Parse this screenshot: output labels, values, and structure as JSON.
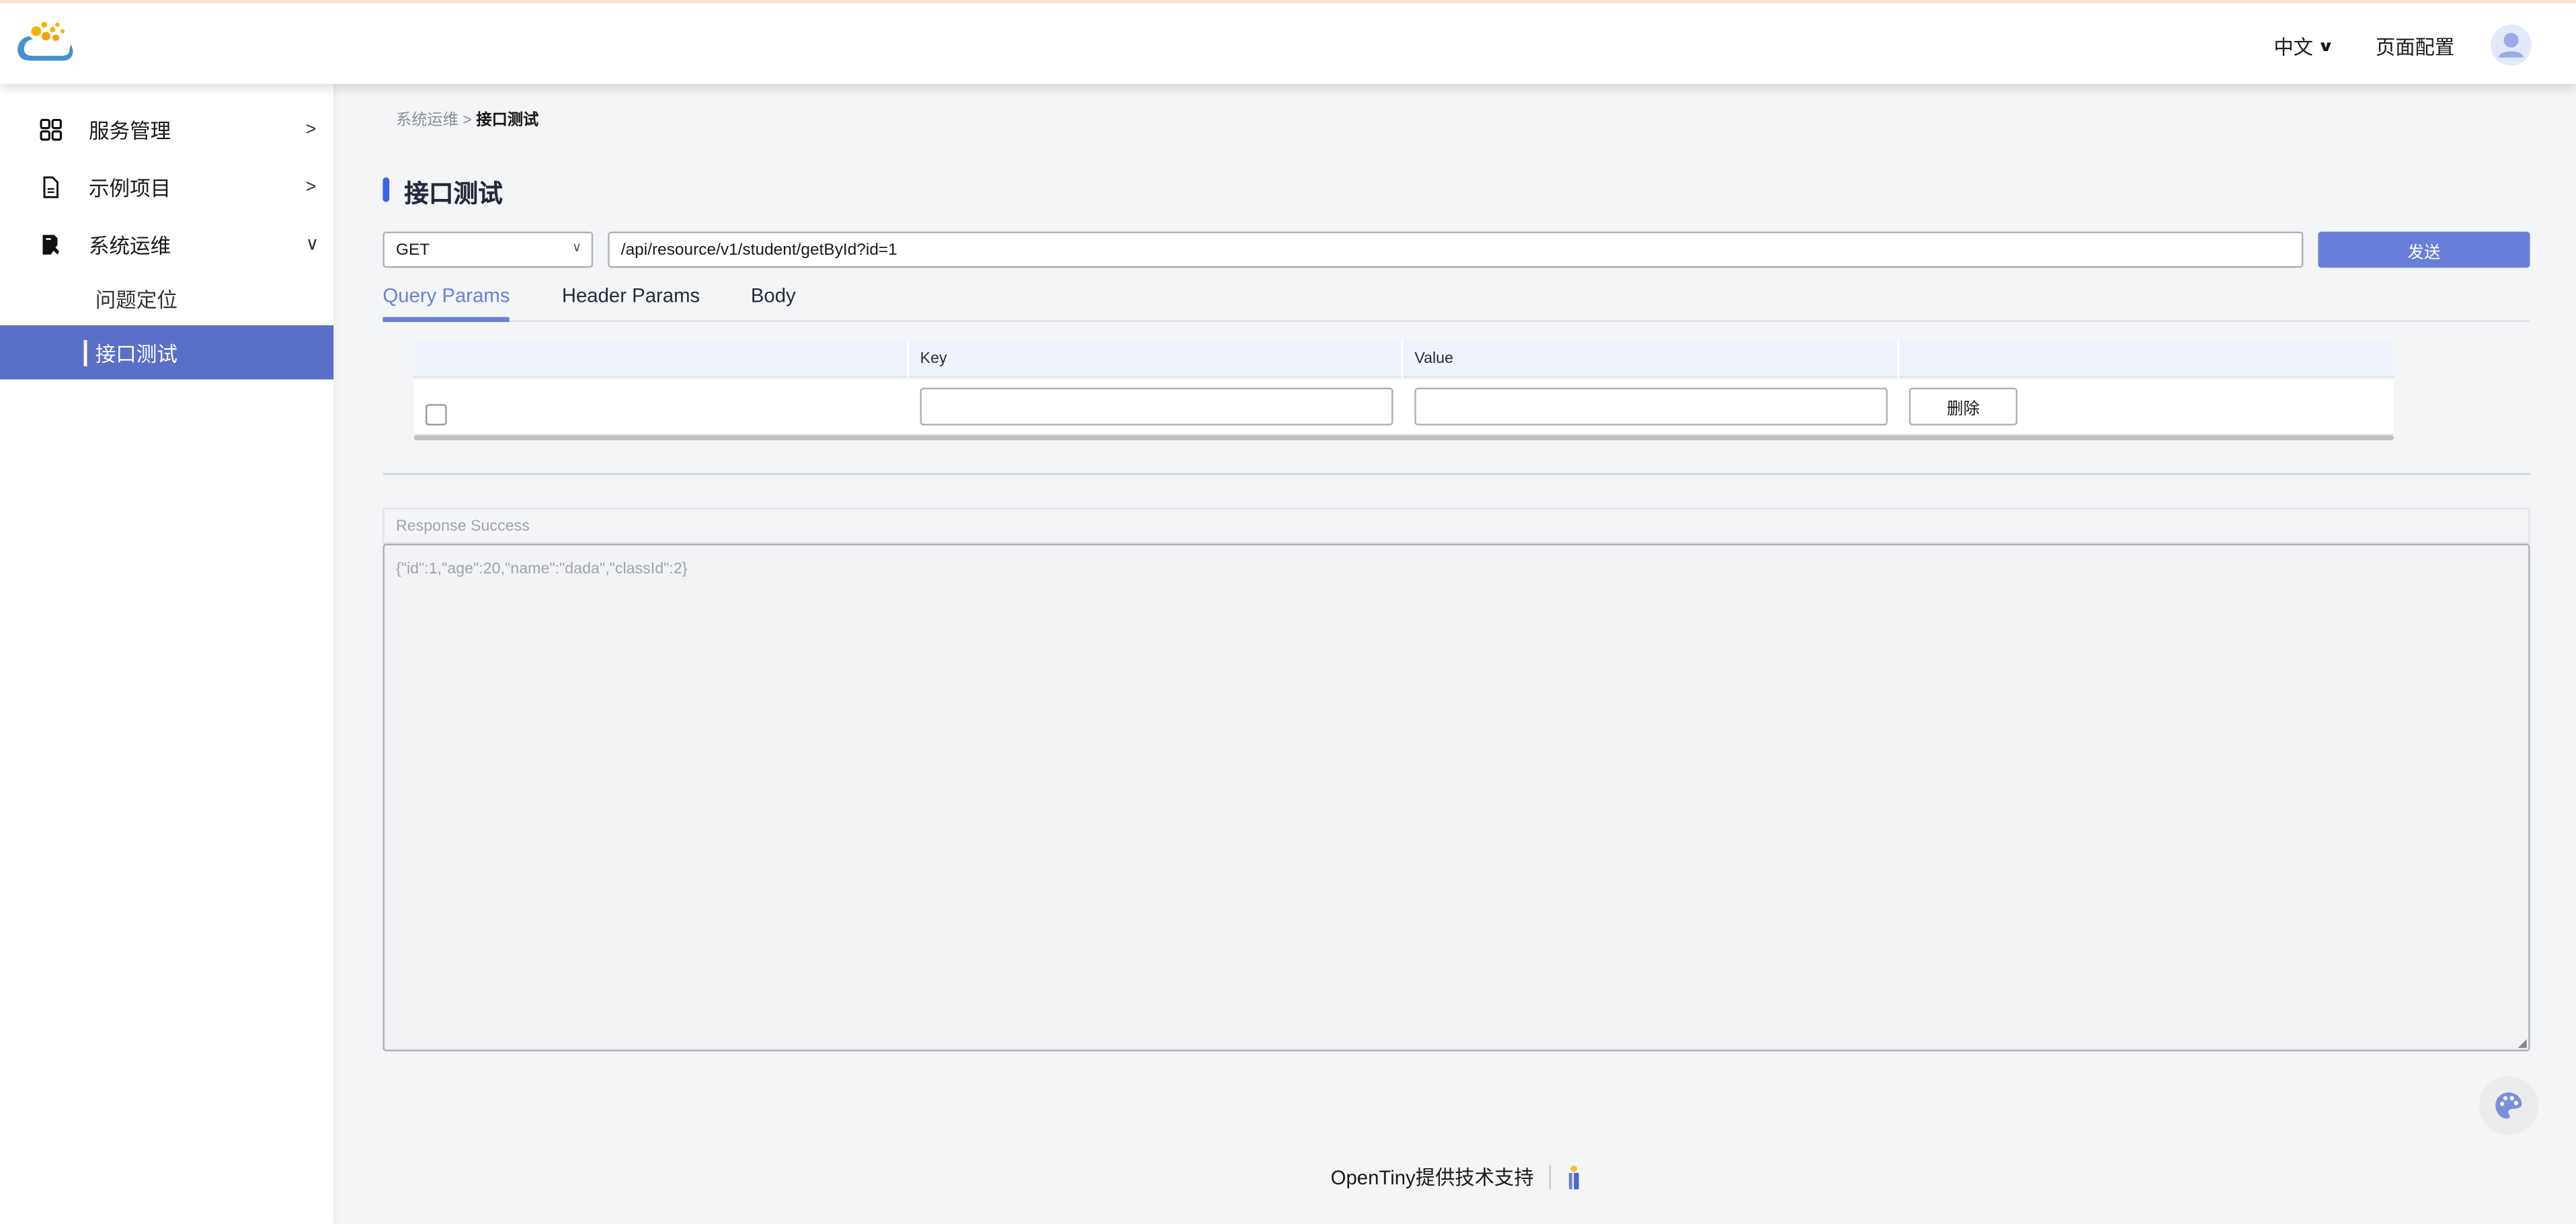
{
  "header": {
    "language": "中文",
    "page_config": "页面配置"
  },
  "sidebar": {
    "items": [
      {
        "label": "服务管理"
      },
      {
        "label": "示例项目"
      },
      {
        "label": "系统运维"
      },
      {
        "label": "问题定位"
      },
      {
        "label": "接口测试"
      }
    ]
  },
  "breadcrumb": {
    "parent": "系统运维",
    "separator": ">",
    "current": "接口测试"
  },
  "page_title": "接口测试",
  "request": {
    "method": "GET",
    "url": "/api/resource/v1/student/getById?id=1",
    "send_label": "发送"
  },
  "tabs": [
    {
      "label": "Query Params"
    },
    {
      "label": "Header Params"
    },
    {
      "label": "Body"
    }
  ],
  "params_table": {
    "headers": [
      "",
      "Key",
      "Value",
      ""
    ],
    "rows": [
      {
        "key": "",
        "value": "",
        "delete_label": "删除"
      }
    ]
  },
  "response": {
    "status": "Response Success",
    "body": "{\"id\":1,\"age\":20,\"name\":\"dada\",\"classId\":2}"
  },
  "footer": {
    "text": "OpenTiny提供技术支持"
  },
  "colors": {
    "primary": "#687fd9",
    "active_nav": "#5a6fc7",
    "title_bar": "#3b63e8"
  }
}
